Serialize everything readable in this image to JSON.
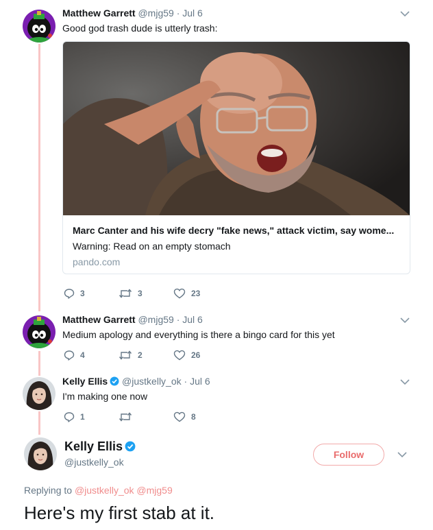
{
  "tweets": [
    {
      "name": "Matthew Garrett",
      "handle": "@mjg59",
      "separator": "·",
      "date": "Jul 6",
      "text": "Good god trash dude is utterly trash:",
      "card": {
        "title": "Marc Canter and his wife decry \"fake news,\" attack victim, say wome...",
        "description": "Warning: Read on an empty stomach",
        "domain": "pando.com"
      },
      "replies": "3",
      "retweets": "3",
      "likes": "23"
    },
    {
      "name": "Matthew Garrett",
      "handle": "@mjg59",
      "separator": "·",
      "date": "Jul 6",
      "text": "Medium apology and everything is there a bingo card for this yet",
      "replies": "4",
      "retweets": "2",
      "likes": "26"
    },
    {
      "name": "Kelly Ellis",
      "handle": "@justkelly_ok",
      "separator": "·",
      "date": "Jul 6",
      "text": "I'm making one now",
      "replies": "1",
      "retweets": "",
      "likes": "8"
    }
  ],
  "main_tweet": {
    "name": "Kelly Ellis",
    "handle": "@justkelly_ok",
    "follow_label": "Follow",
    "replying_prefix": "Replying to",
    "mention_1": "@justkelly_ok",
    "mention_2": "@mjg59",
    "text": "Here's my first stab at it."
  },
  "colors": {
    "accent": "#e96b6b",
    "thread_line": "#f9c5c5",
    "verified": "#1da1f2",
    "muted": "#657786"
  },
  "icons": [
    "chevron-down-icon",
    "reply-icon",
    "retweet-icon",
    "heart-icon",
    "verified-badge-icon"
  ]
}
